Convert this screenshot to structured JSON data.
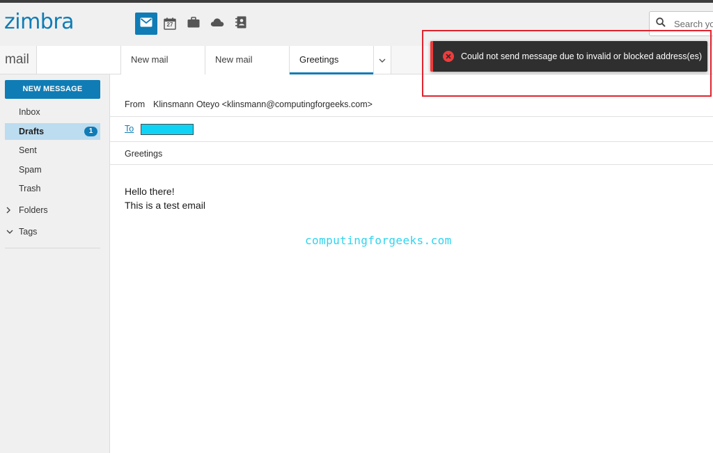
{
  "app": {
    "logo_text": "zimbra",
    "colors": {
      "brand": "#0f7cb5",
      "error": "#f23b3b",
      "toast_bg": "#2f2f2f",
      "highlight": "#e0232e"
    }
  },
  "header": {
    "apps": [
      {
        "icon": "mail-icon",
        "active": true
      },
      {
        "icon": "calendar-icon",
        "label": "27",
        "active": false
      },
      {
        "icon": "briefcase-icon",
        "active": false
      },
      {
        "icon": "cloud-icon",
        "active": false
      },
      {
        "icon": "contacts-icon",
        "active": false
      }
    ],
    "search": {
      "placeholder": "Search yo",
      "icon": "search-icon"
    }
  },
  "tabbar": {
    "section": "mail",
    "tabs": [
      {
        "label": "New mail",
        "active": false
      },
      {
        "label": "New mail",
        "active": false
      },
      {
        "label": "Greetings",
        "active": true
      }
    ],
    "menu_icon": "chevron-down-icon"
  },
  "sidebar": {
    "new_message_label": "NEW MESSAGE",
    "folders": [
      {
        "label": "Inbox"
      },
      {
        "label": "Drafts",
        "count": "1",
        "active": true
      },
      {
        "label": "Sent"
      },
      {
        "label": "Spam"
      },
      {
        "label": "Trash"
      }
    ],
    "folders_group": {
      "label": "Folders",
      "expanded": false
    },
    "tags_group": {
      "label": "Tags",
      "expanded": true
    }
  },
  "compose": {
    "from_label": "From",
    "from_value": "Klinsmann Oteyo <klinsmann@computingforgeeks.com>",
    "to_label": "To",
    "subject": "Greetings",
    "body_line1": "Hello there!",
    "body_line2": "This is a test email",
    "watermark": "computingforgeeks.com"
  },
  "notification": {
    "type": "error",
    "message": "Could not send message due to invalid or blocked address(es)"
  }
}
